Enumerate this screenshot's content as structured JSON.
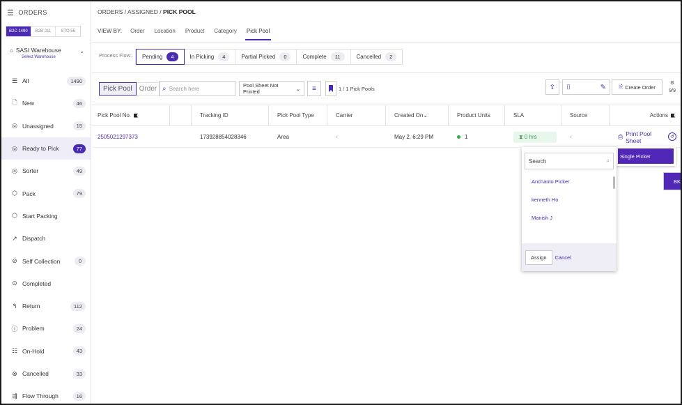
{
  "sidebar": {
    "title": "ORDERS",
    "channels": [
      "B2C 1490",
      "B2B 211",
      "STO 55"
    ],
    "warehouse": {
      "name": "SASI Warehouse",
      "sub": "Select Warehouse"
    },
    "items": [
      {
        "label": "All",
        "count": "1490"
      },
      {
        "label": "New",
        "count": "46"
      },
      {
        "label": "Unassigned",
        "count": "15"
      },
      {
        "label": "Ready to Pick",
        "count": "77"
      },
      {
        "label": "Sorter",
        "count": "49"
      },
      {
        "label": "Pack",
        "count": "79"
      },
      {
        "label": "Start Packing",
        "count": ""
      },
      {
        "label": "Dispatch",
        "count": ""
      },
      {
        "label": "Self Collection",
        "count": "0"
      },
      {
        "label": "Completed",
        "count": ""
      },
      {
        "label": "Return",
        "count": "112"
      },
      {
        "label": "Problem",
        "count": "24"
      },
      {
        "label": "On-Hold",
        "count": "43"
      },
      {
        "label": "Cancelled",
        "count": "33"
      },
      {
        "label": "Flow Through",
        "count": "16"
      }
    ]
  },
  "breadcrumb": {
    "a": "ORDERS",
    "b": "ASSIGNED",
    "c": "PICK POOL"
  },
  "viewby": {
    "label": "VIEW BY:",
    "tabs": [
      "Order",
      "Location",
      "Product",
      "Category",
      "Pick Pool"
    ]
  },
  "process_flow": {
    "label": "Process Flow:",
    "steps": [
      {
        "label": "Pending",
        "count": "4"
      },
      {
        "label": "In Picking",
        "count": "4"
      },
      {
        "label": "Partial Picked",
        "count": "0"
      },
      {
        "label": "Complete",
        "count": "11"
      },
      {
        "label": "Cancelled",
        "count": "2"
      }
    ]
  },
  "toolbar": {
    "toggle_on": "Pick Pool",
    "toggle_off": "Order",
    "search_placeholder": "Search here",
    "filter_value": "Pool Sheet Not Printed",
    "pool_count": "1 / 1 Pick Pools",
    "create_order": "Create Order",
    "columns": "9/9"
  },
  "table": {
    "headers": [
      "Pick Pool No.",
      "",
      "Tracking ID",
      "Pick Pool Type",
      "Carrier",
      "Created On",
      "Product Units",
      "SLA",
      "Source",
      "Actions"
    ],
    "row": {
      "pick_pool_no": "2505021297373",
      "tracking_id": "173928854028346",
      "type": "Area",
      "carrier": "-",
      "created_on": "May 2, 6:29 PM",
      "units": "1",
      "sla": "0 hrs",
      "source": "-",
      "action": "Print Pool Sheet"
    }
  },
  "single_picker": "Single Picker",
  "picker": {
    "search_placeholder": "Search",
    "options": [
      "Anchanto Picker",
      "BKL BKL",
      "kenneth Ho",
      "Manish J"
    ],
    "assign": "Assign",
    "cancel": "Cancel"
  }
}
